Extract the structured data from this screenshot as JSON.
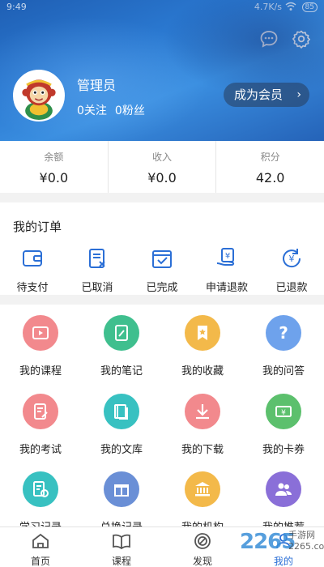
{
  "status": {
    "time": "9:49",
    "speed": "4.7K/s",
    "battery": "85"
  },
  "profile": {
    "name": "管理员",
    "follow": "0关注",
    "fans": "0粉丝",
    "member_button": "成为会员"
  },
  "stats": [
    {
      "label": "余额",
      "value": "¥0.0"
    },
    {
      "label": "收入",
      "value": "¥0.0"
    },
    {
      "label": "积分",
      "value": "42.0"
    }
  ],
  "orders": {
    "title": "我的订单",
    "items": [
      {
        "label": "待支付",
        "icon": "wallet-icon"
      },
      {
        "label": "已取消",
        "icon": "cancelled-doc-icon"
      },
      {
        "label": "已完成",
        "icon": "calendar-check-icon"
      },
      {
        "label": "申请退款",
        "icon": "refund-request-icon"
      },
      {
        "label": "已退款",
        "icon": "refunded-yen-icon"
      }
    ]
  },
  "grid": [
    {
      "label": "我的课程",
      "icon": "play-icon",
      "color": "#f2898d"
    },
    {
      "label": "我的笔记",
      "icon": "note-icon",
      "color": "#3fbf8e"
    },
    {
      "label": "我的收藏",
      "icon": "bookmark-star-icon",
      "color": "#f3b94a"
    },
    {
      "label": "我的问答",
      "icon": "question-icon",
      "color": "#6ea2ec"
    },
    {
      "label": "我的考试",
      "icon": "exam-icon",
      "color": "#f2898d"
    },
    {
      "label": "我的文库",
      "icon": "library-icon",
      "color": "#38c1c1"
    },
    {
      "label": "我的下载",
      "icon": "download-icon",
      "color": "#f2898d"
    },
    {
      "label": "我的卡券",
      "icon": "coupon-icon",
      "color": "#5cc06d"
    },
    {
      "label": "学习记录",
      "icon": "study-record-icon",
      "color": "#38c1c1"
    },
    {
      "label": "兑换记录",
      "icon": "gift-icon",
      "color": "#6a8fd6"
    },
    {
      "label": "我的机构",
      "icon": "institution-icon",
      "color": "#f3b94a"
    },
    {
      "label": "我的推荐",
      "icon": "people-icon",
      "color": "#8a6fd8"
    }
  ],
  "tabs": [
    {
      "label": "首页",
      "icon": "home-icon"
    },
    {
      "label": "课程",
      "icon": "book-icon"
    },
    {
      "label": "发现",
      "icon": "compass-icon"
    },
    {
      "label": "我的",
      "icon": "person-icon"
    }
  ],
  "watermark": {
    "brand": "2265",
    "sub": "手游网",
    "url": "2265.com"
  },
  "accent": "#2b6fd6"
}
